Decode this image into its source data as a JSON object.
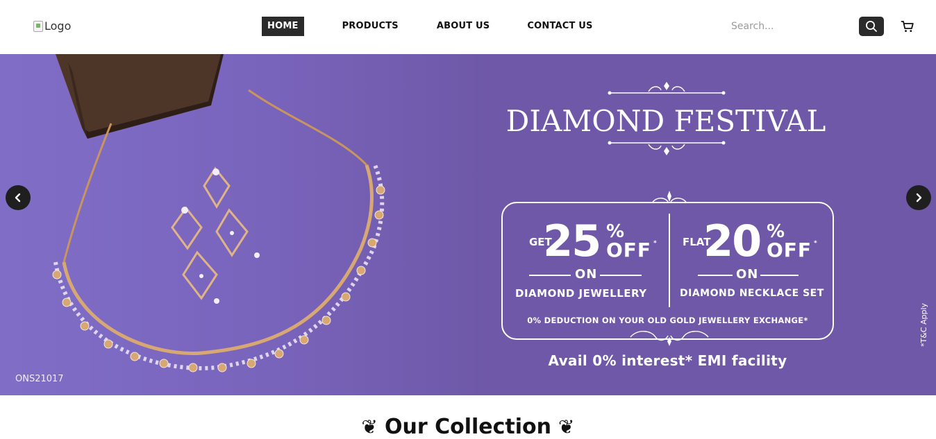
{
  "header": {
    "logo_alt": "Logo",
    "nav": [
      {
        "label": "HOME",
        "active": true
      },
      {
        "label": "PRODUCTS",
        "active": false
      },
      {
        "label": "ABOUT US",
        "active": false
      },
      {
        "label": "CONTACT US",
        "active": false
      }
    ],
    "search": {
      "placeholder": "Search...",
      "value": ""
    },
    "icons": {
      "search": "search-icon",
      "cart": "cart-icon"
    }
  },
  "hero": {
    "sku": "ONS21017",
    "title": "DIAMOND FESTIVAL",
    "offers": [
      {
        "prefix": "GET",
        "value": "25",
        "percent": "%",
        "off": "OFF",
        "asterisk": "*",
        "on": "ON",
        "label": "DIAMOND JEWELLERY"
      },
      {
        "prefix": "FLAT",
        "value": "20",
        "percent": "%",
        "off": "OFF",
        "asterisk": "*",
        "on": "ON",
        "label": "DIAMOND NECKLACE SET"
      }
    ],
    "deduction": "0% DEDUCTION ON YOUR OLD GOLD JEWELLERY EXCHANGE*",
    "emi": "Avail 0% interest* EMI facility",
    "tc": "*T&C Apply",
    "colors": {
      "background": "#6e58a7",
      "text": "#ffffff",
      "arrow": "#1f1f1f"
    },
    "icons": {
      "prev": "chevron-left-icon",
      "next": "chevron-right-icon"
    }
  },
  "collection": {
    "title": "Our Collection",
    "flourish": "❦"
  }
}
